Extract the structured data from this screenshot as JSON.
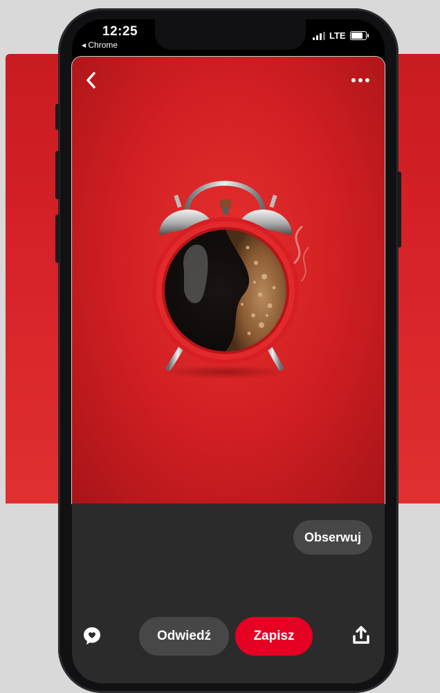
{
  "status_bar": {
    "time": "12:25",
    "back_app": "◂ Chrome",
    "network": "LTE"
  },
  "pin": {
    "image_icon": "alarm-clock-coffee-image",
    "back_icon": "chevron-left-icon",
    "more_icon": "more-dots-icon"
  },
  "actions": {
    "follow_label": "Obserwuj",
    "visit_label": "Odwiedź",
    "save_label": "Zapisz",
    "comment_icon": "heart-speech-bubble-icon",
    "share_icon": "share-upload-icon"
  },
  "colors": {
    "brand_red": "#e60023",
    "image_red": "#d21f23",
    "panel_dark": "#2b2b2b",
    "pill_gray": "#474747"
  }
}
